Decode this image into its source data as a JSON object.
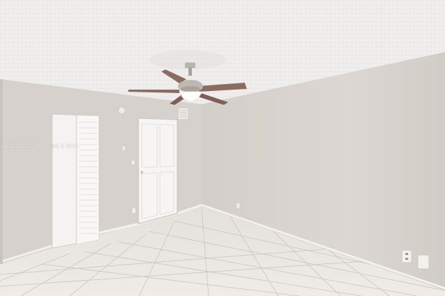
{
  "watermark": {
    "text": "A1181923 © Miami MLS 2025"
  },
  "colors": {
    "ceiling": "#efedeb",
    "wall_left": "#d6d1cc",
    "wall_back": "#d9d4cf",
    "wall_right": "#d8d3ce",
    "floor_tile": "#ebe7e2",
    "grout": "#c9c3bc",
    "door": "#f5f4f2",
    "fan_blade": "#8b6b62",
    "fan_metal": "#b9b4ae"
  }
}
